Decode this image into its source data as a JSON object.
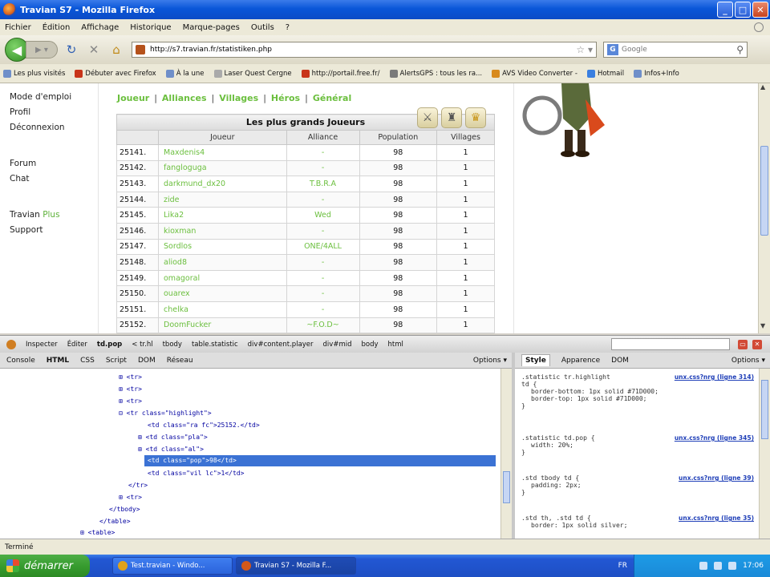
{
  "window": {
    "title": "Travian S7 - Mozilla Firefox"
  },
  "menu": [
    "Fichier",
    "Édition",
    "Affichage",
    "Historique",
    "Marque-pages",
    "Outils",
    "?"
  ],
  "nav": {
    "url": "http://s7.travian.fr/statistiken.php",
    "search_placeholder": "Google"
  },
  "bookmarks": [
    "Les plus visités",
    "Débuter avec Firefox",
    "À la une",
    "Laser Quest Cergne",
    "http://portail.free.fr/",
    "AlertsGPS : tous les ra...",
    "AVS Video Converter -",
    "Hotmail",
    "Infos+Info"
  ],
  "sidebar": {
    "group1": [
      "Mode d'emploi",
      "Profil",
      "Déconnexion"
    ],
    "group2": [
      "Forum",
      "Chat"
    ],
    "travian": "Travian",
    "plus": "Plus",
    "support": "Support"
  },
  "stats_tabs": [
    "Joueur",
    "Alliances",
    "Villages",
    "Héros",
    "Général"
  ],
  "table": {
    "caption": "Les plus grands Joueurs",
    "headers": [
      "",
      "Joueur",
      "Alliance",
      "Population",
      "Villages"
    ],
    "rows": [
      [
        "25141.",
        "Maxdenis4",
        "-",
        "98",
        "1"
      ],
      [
        "25142.",
        "fangloguga",
        "-",
        "98",
        "1"
      ],
      [
        "25143.",
        "darkmund_dx20",
        "T.B.R.A",
        "98",
        "1"
      ],
      [
        "25144.",
        "zide",
        "-",
        "98",
        "1"
      ],
      [
        "25145.",
        "Lika2",
        "Wed",
        "98",
        "1"
      ],
      [
        "25146.",
        "kioxman",
        "-",
        "98",
        "1"
      ],
      [
        "25147.",
        "Sordlos",
        "ONE/4ALL",
        "98",
        "1"
      ],
      [
        "25148.",
        "aliod8",
        "-",
        "98",
        "1"
      ],
      [
        "25149.",
        "omagoral",
        "-",
        "98",
        "1"
      ],
      [
        "25150.",
        "ouarex",
        "-",
        "98",
        "1"
      ],
      [
        "25151.",
        "chelka",
        "-",
        "98",
        "1"
      ],
      [
        "25152.",
        "DoomFucker",
        "~F.O.D~",
        "98",
        "1"
      ]
    ]
  },
  "firebug": {
    "toolbar": [
      "Inspecter",
      "Éditer",
      "td.pop",
      "< tr.hl",
      "tbody",
      "table.statistic",
      "div#content.player",
      "div#mid",
      "body",
      "html"
    ],
    "tabs": [
      "Console",
      "HTML",
      "CSS",
      "Script",
      "DOM",
      "Réseau"
    ],
    "options": "Options ▾",
    "style_tabs": [
      "Style",
      "Apparence",
      "DOM"
    ],
    "html_lines": [
      "⊞ <tr>",
      "⊞ <tr>",
      "⊞ <tr>",
      "⊟ <tr class=\"highlight\">",
      "<td class=\"ra fc\">25152.</td>",
      "⊞ <td class=\"pla\">",
      "⊞ <td class=\"al\">",
      "<td class=\"pop\">98</td>",
      "<td class=\"vil lc\">1</td>",
      "</tr>",
      "⊞ <tr>",
      "</tbody>",
      "</table>",
      "⊞ <table>"
    ],
    "style_rules": [
      {
        "selector": ".statistic tr.highlight",
        "source": "unx.css?nrg (ligne 314)",
        "props": [
          "td {",
          "border-bottom: 1px solid #71D000;",
          "border-top: 1px solid #71D000;",
          "}"
        ]
      },
      {
        "selector": ".statistic td.pop {",
        "source": "unx.css?nrg (ligne 345)",
        "props": [
          "width: 20%;",
          "}"
        ]
      },
      {
        "selector": ".std tbody td {",
        "source": "unx.css?nrg (ligne 39)",
        "props": [
          "padding: 2px;",
          "}"
        ]
      },
      {
        "selector": ".std th, .std td {",
        "source": "unx.css?nrg (ligne 35)",
        "props": [
          "border: 1px solid silver;"
        ]
      }
    ]
  },
  "status": "Terminé",
  "taskbar": {
    "start": "démarrer",
    "tasks": [
      "Test.travian - Windo...",
      "Travian S7 - Mozilla F..."
    ],
    "lang": "FR",
    "clock": "17:06"
  }
}
